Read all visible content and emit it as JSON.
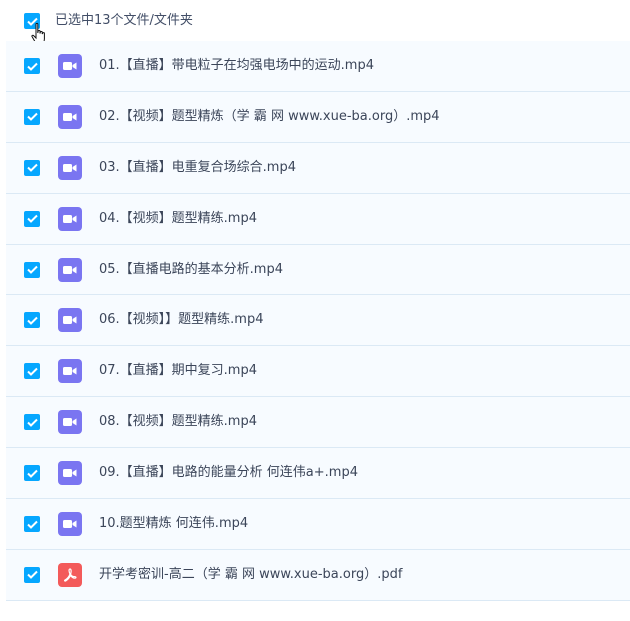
{
  "header": {
    "selection_text": "已选中13个文件/文件夹"
  },
  "colors": {
    "checkbox": "#06a7ff",
    "video_icon": "#7a75f1",
    "pdf_icon": "#f35a5a",
    "row_bg": "#f7fbff"
  },
  "files": [
    {
      "name": "01.【直播】带电粒子在均强电场中的运动.mp4",
      "type": "video-icon"
    },
    {
      "name": "02.【视频】题型精炼（学 霸 网 www.xue-ba.org）.mp4",
      "type": "video-icon"
    },
    {
      "name": "03.【直播】电重复合场综合.mp4",
      "type": "video-icon"
    },
    {
      "name": "04.【视频】题型精练.mp4",
      "type": "video-icon"
    },
    {
      "name": "05.【直播电路的基本分析.mp4",
      "type": "video-icon"
    },
    {
      "name": "06.【视频】】题型精练.mp4",
      "type": "video-icon"
    },
    {
      "name": "07.【直播】期中复习.mp4",
      "type": "video-icon"
    },
    {
      "name": "08.【视频】题型精练.mp4",
      "type": "video-icon"
    },
    {
      "name": "09.【直播】电路的能量分析 何连伟a+.mp4",
      "type": "video-icon"
    },
    {
      "name": "10.题型精炼 何连伟.mp4",
      "type": "video-icon"
    },
    {
      "name": "开学考密训-高二（学 霸 网 www.xue-ba.org）.pdf",
      "type": "pdf-icon"
    }
  ]
}
